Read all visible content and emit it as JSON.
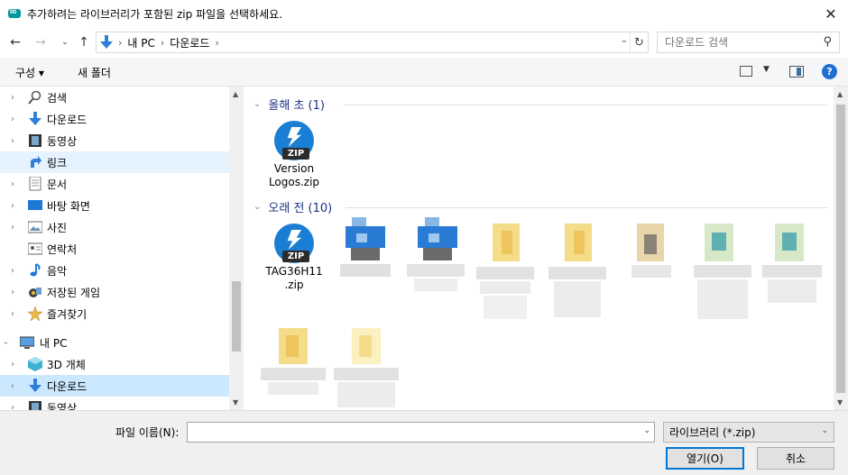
{
  "window": {
    "title": "추가하려는 라이브러리가 포함된 zip 파일을 선택하세요.",
    "close_glyph": "✕"
  },
  "address_bar": {
    "crumbs": [
      "내 PC",
      "다운로드"
    ],
    "search_placeholder": "다운로드 검색"
  },
  "command_bar": {
    "organize_label": "구성 ▾",
    "new_folder_label": "새 폴더",
    "help_label": "?"
  },
  "nav_pane": {
    "items": [
      {
        "label": "검색",
        "icon": "search-icon"
      },
      {
        "label": "다운로드",
        "icon": "download-arrow-icon"
      },
      {
        "label": "동영상",
        "icon": "video-icon"
      },
      {
        "label": "링크",
        "icon": "link-icon"
      },
      {
        "label": "문서",
        "icon": "document-icon"
      },
      {
        "label": "바탕 화면",
        "icon": "desktop-icon"
      },
      {
        "label": "사진",
        "icon": "pictures-icon"
      },
      {
        "label": "연락처",
        "icon": "contacts-icon"
      },
      {
        "label": "음악",
        "icon": "music-icon"
      },
      {
        "label": "저장된 게임",
        "icon": "saved-games-icon"
      },
      {
        "label": "즐겨찾기",
        "icon": "favorites-icon"
      },
      {
        "label": "내 PC",
        "icon": "this-pc-icon"
      },
      {
        "label": "3D 개체",
        "icon": "3d-objects-icon"
      },
      {
        "label": "다운로드",
        "icon": "download-arrow-icon"
      },
      {
        "label": "동영상",
        "icon": "video-icon"
      }
    ]
  },
  "content": {
    "groups": [
      {
        "label": "올해 초 (1)"
      },
      {
        "label": "오래 전 (10)"
      }
    ],
    "files": [
      {
        "name_line1": "Version",
        "name_line2": "Logos.zip"
      },
      {
        "name_line1": "TAG36H11",
        "name_line2": ".zip"
      }
    ]
  },
  "bottom": {
    "filename_label": "파일 이름(N):",
    "filename_value": "",
    "filter_value": "라이브러리 (*.zip)",
    "open_label": "열기(O)",
    "cancel_label": "취소"
  },
  "colors": {
    "accent": "#0078d7",
    "selected_bg": "#cce8ff",
    "group_header": "#1e3287",
    "zip_blue": "#1a7fd4"
  }
}
